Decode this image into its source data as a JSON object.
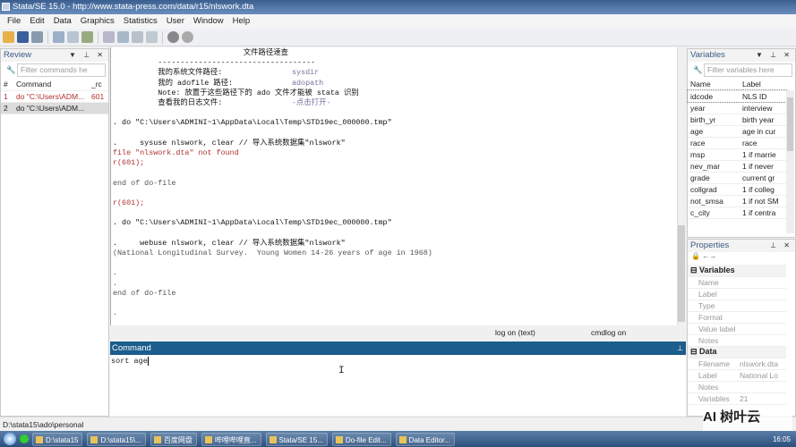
{
  "window": {
    "title": "Stata/SE 15.0 - http://www.stata-press.com/data/r15/nlswork.dta"
  },
  "menu": [
    "File",
    "Edit",
    "Data",
    "Graphics",
    "Statistics",
    "User",
    "Window",
    "Help"
  ],
  "review": {
    "title": "Review",
    "filter_placeholder": "Filter commands he",
    "col_num": "#",
    "col_command": "Command",
    "col_rc": "_rc",
    "rows": [
      {
        "num": "1",
        "command": "do \"C:\\Users\\ADM...",
        "rc": "601"
      },
      {
        "num": "2",
        "command": "do \"C:\\Users\\ADM...",
        "rc": ""
      }
    ]
  },
  "results": {
    "lines": [
      {
        "text": "                             文件路径速查",
        "kind": "cmd"
      },
      {
        "text": "          -----------------------------------",
        "kind": "cmd"
      },
      {
        "text": "          我的系统文件路径:",
        "kind": "cmd",
        "value": "sysdir"
      },
      {
        "text": "          我的 adofile 路径:",
        "kind": "cmd",
        "value": "adopath"
      },
      {
        "text": "          Note: 放置于这些路径下的 ado 文件才能被 stata 识别",
        "kind": "cmd"
      },
      {
        "text": "          查看我的日志文件:",
        "kind": "cmd",
        "value": "-点击打开-"
      },
      {
        "text": "",
        "kind": "out"
      },
      {
        "text": ". do \"C:\\Users\\ADMINI~1\\AppData\\Local\\Temp\\STD19ec_000000.tmp\"",
        "kind": "cmd"
      },
      {
        "text": "",
        "kind": "out"
      },
      {
        "text": ".     sysuse nlswork, clear // 导入系统数据集\"nlswork\"",
        "kind": "cmd"
      },
      {
        "text": "file \"nlswork.dta\" not found",
        "kind": "err"
      },
      {
        "text": "r(601);",
        "kind": "err"
      },
      {
        "text": "",
        "kind": "out"
      },
      {
        "text": "end of do-file",
        "kind": "out"
      },
      {
        "text": "",
        "kind": "out"
      },
      {
        "text": "r(601);",
        "kind": "err"
      },
      {
        "text": "",
        "kind": "out"
      },
      {
        "text": ". do \"C:\\Users\\ADMINI~1\\AppData\\Local\\Temp\\STD19ec_000000.tmp\"",
        "kind": "cmd"
      },
      {
        "text": "",
        "kind": "out"
      },
      {
        "text": ".     webuse nlswork, clear // 导入系统数据集\"nlswork\"",
        "kind": "cmd"
      },
      {
        "text": "(National Longitudinal Survey.  Young Women 14-26 years of age in 1968)",
        "kind": "out"
      },
      {
        "text": "",
        "kind": "out"
      },
      {
        "text": ".",
        "kind": "out"
      },
      {
        "text": ".",
        "kind": "out"
      },
      {
        "text": "end of do-file",
        "kind": "out"
      },
      {
        "text": "",
        "kind": "out"
      },
      {
        "text": ".",
        "kind": "out"
      }
    ]
  },
  "strip": {
    "log": "log on (text)",
    "cmdlog": "cmdlog on"
  },
  "command": {
    "title": "Command",
    "value": "sort age"
  },
  "variables": {
    "title": "Variables",
    "filter_placeholder": "Filter variables here",
    "col_name": "Name",
    "col_label": "Label",
    "rows": [
      [
        "idcode",
        "NLS ID"
      ],
      [
        "year",
        "interview"
      ],
      [
        "birth_yr",
        "birth year"
      ],
      [
        "age",
        "age in cur"
      ],
      [
        "race",
        "race"
      ],
      [
        "msp",
        "1 if marrie"
      ],
      [
        "nev_mar",
        "1 if never"
      ],
      [
        "grade",
        "current gr"
      ],
      [
        "collgrad",
        "1 if colleg"
      ],
      [
        "not_smsa",
        "1 if not SM"
      ],
      [
        "c_city",
        "1 if centra"
      ]
    ]
  },
  "properties": {
    "title": "Properties",
    "variables_group": "Variables",
    "variables_fields": [
      "Name",
      "Label",
      "Type",
      "Format",
      "Value label",
      "Notes"
    ],
    "data_group": "Data",
    "data_fields": [
      [
        "Filename",
        "nlswork.dta"
      ],
      [
        "Label",
        "National Lo"
      ],
      [
        "Notes",
        ""
      ],
      [
        "Variables",
        "21"
      ]
    ]
  },
  "statusbar": {
    "path": "D:\\stata15\\ado\\personal"
  },
  "taskbar": {
    "items": [
      "D:\\stata15",
      "D:\\stata15\\...",
      "百度网盘",
      "哔哩哔哩直...",
      "Stata/SE 15...",
      "Do-file Edit...",
      "Data Editor..."
    ],
    "clock": "16:05"
  },
  "watermark": "AI 树叶云"
}
